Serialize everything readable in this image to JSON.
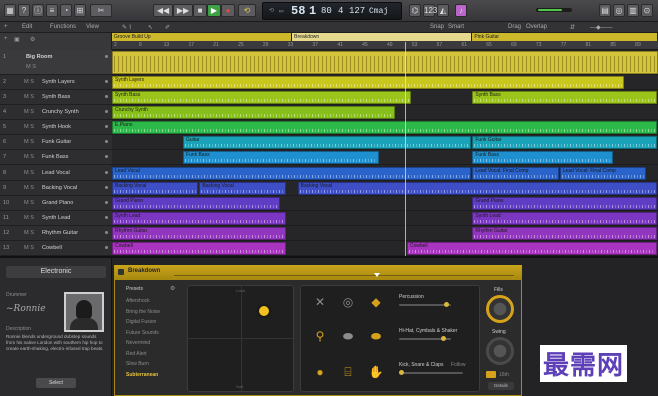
{
  "transport": {
    "rewind_label": "◀◀",
    "forward_label": "▶▶",
    "play_label": "▶",
    "record_label": "●",
    "cycle_label": "⟲"
  },
  "lcd": {
    "bar": "58",
    "beat": "1",
    "bpm": "80",
    "time_sig_top": "4",
    "time_sig": "127",
    "key": "Cmaj"
  },
  "options_bar": {
    "edit": "Edit",
    "functions": "Functions",
    "view": "View",
    "snap_label": "Snap",
    "snap_value": "Smart",
    "drag_label": "Drag",
    "drag_value": "Overlap"
  },
  "ruler_ticks": [
    "2",
    "9",
    "13",
    "17",
    "21",
    "25",
    "29",
    "33",
    "37",
    "41",
    "45",
    "49",
    "53",
    "57",
    "61",
    "65",
    "69",
    "73",
    "77",
    "81",
    "85",
    "89"
  ],
  "arrangement": [
    {
      "label": "Groove Build Up",
      "start": 0,
      "end": 0.33,
      "color": "#cdb72a"
    },
    {
      "label": "Breakdown",
      "start": 0.33,
      "end": 0.66,
      "color": "#e6d98e"
    },
    {
      "label": "Pink Guitar",
      "start": 0.66,
      "end": 1,
      "color": "#cdb72a"
    }
  ],
  "tracks": [
    {
      "num": "1",
      "name": "Big Room",
      "color": "#cdb72a"
    },
    {
      "num": "2",
      "name": "Synth Layers",
      "color": "#c9c61e"
    },
    {
      "num": "3",
      "name": "Synth Bass",
      "color": "#9bc51b"
    },
    {
      "num": "4",
      "name": "Crunchy Synth",
      "color": "#86bf19"
    },
    {
      "num": "5",
      "name": "Synth Hook",
      "color": "#2db84a"
    },
    {
      "num": "6",
      "name": "Funk Guitar",
      "color": "#1aa3b8"
    },
    {
      "num": "7",
      "name": "Funk Bass",
      "color": "#1e8fcf"
    },
    {
      "num": "8",
      "name": "Lead Vocal",
      "color": "#2a63c9"
    },
    {
      "num": "9",
      "name": "Backing Vocal",
      "color": "#3d4ec7"
    },
    {
      "num": "10",
      "name": "Grand Piano",
      "color": "#5f3dc4"
    },
    {
      "num": "11",
      "name": "Synth Lead",
      "color": "#7b37c2"
    },
    {
      "num": "12",
      "name": "Rhythm Guitar",
      "color": "#9336bf"
    },
    {
      "num": "13",
      "name": "Cowbell",
      "color": "#a834c0"
    }
  ],
  "regions": [
    {
      "row": 1,
      "label": "Synth Layers",
      "start": 0,
      "end": 0.94,
      "color": "#c9c61e"
    },
    {
      "row": 2,
      "label": "Synth Bass",
      "start": 0,
      "end": 0.55,
      "color": "#9bc51b"
    },
    {
      "row": 2,
      "label": "Synth Bass",
      "start": 0.66,
      "end": 1,
      "color": "#9bc51b"
    },
    {
      "row": 3,
      "label": "Crunchy Synth",
      "start": 0,
      "end": 0.52,
      "color": "#86bf19"
    },
    {
      "row": 4,
      "label": "E.Piano",
      "start": 0,
      "end": 1,
      "color": "#2db84a"
    },
    {
      "row": 5,
      "label": "Guitar",
      "start": 0.13,
      "end": 0.66,
      "color": "#1aa3b8"
    },
    {
      "row": 5,
      "label": "Funk Guitar",
      "start": 0.66,
      "end": 1,
      "color": "#1aa3b8"
    },
    {
      "row": 6,
      "label": "Funk Bass",
      "start": 0.13,
      "end": 0.49,
      "color": "#1e8fcf"
    },
    {
      "row": 6,
      "label": "Funk Bass",
      "start": 0.66,
      "end": 0.92,
      "color": "#1e8fcf"
    },
    {
      "row": 7,
      "label": "Lead Vocal",
      "start": 0,
      "end": 0.66,
      "color": "#2a63c9"
    },
    {
      "row": 7,
      "label": "Lead Vocal: Final Comp",
      "start": 0.66,
      "end": 0.82,
      "color": "#2a63c9"
    },
    {
      "row": 7,
      "label": "Lead Vocal: Final Comp",
      "start": 0.82,
      "end": 0.98,
      "color": "#2a63c9"
    },
    {
      "row": 8,
      "label": "Backing Vocal",
      "start": 0,
      "end": 0.16,
      "color": "#3d4ec7"
    },
    {
      "row": 8,
      "label": "Backing Vocal",
      "start": 0.16,
      "end": 0.32,
      "color": "#3d4ec7"
    },
    {
      "row": 8,
      "label": "Backing Vocal",
      "start": 0.34,
      "end": 1,
      "color": "#3d4ec7"
    },
    {
      "row": 9,
      "label": "Grand Piano",
      "start": 0,
      "end": 0.31,
      "color": "#5f3dc4"
    },
    {
      "row": 9,
      "label": "Grand Piano",
      "start": 0.66,
      "end": 1,
      "color": "#5f3dc4"
    },
    {
      "row": 10,
      "label": "Synth Lead",
      "start": 0,
      "end": 0.32,
      "color": "#7b37c2"
    },
    {
      "row": 10,
      "label": "Synth Lead",
      "start": 0.66,
      "end": 1,
      "color": "#7b37c2"
    },
    {
      "row": 11,
      "label": "Rhythm Guitar",
      "start": 0,
      "end": 0.32,
      "color": "#9336bf"
    },
    {
      "row": 11,
      "label": "Rhythm Guitar",
      "start": 0.66,
      "end": 1,
      "color": "#9336bf"
    },
    {
      "row": 12,
      "label": "Cowbell",
      "start": 0,
      "end": 0.32,
      "color": "#a834c0"
    },
    {
      "row": 12,
      "label": "Cowbell",
      "start": 0.54,
      "end": 1,
      "color": "#a834c0"
    }
  ],
  "library": {
    "title": "Electronic",
    "drummer_label": "Drummer",
    "description_label": "Description",
    "description": "Ronnie blends underground dubstep sounds from his native London with southern hip hop to create earth-shaking, electro-infused trap beats.",
    "select_button": "Select"
  },
  "smart_panel": {
    "title": "Breakdown",
    "presets_label": "Presets",
    "presets": [
      "Aftershock",
      "Bring the Noise",
      "Digital Fusion",
      "Future Sounds",
      "Nevermind",
      "Red Alert",
      "Slow Burn",
      "Subterranean"
    ],
    "selected_preset": "Subterranean",
    "xy_top": "Loud",
    "xy_bottom": "Soft",
    "xy_left": "Simple",
    "xy_right": "Complex",
    "percussion_label": "Percussion",
    "hihat_label": "Hi-Hat, Cymbals & Shaker",
    "kick_label": "Kick, Snare & Claps",
    "follow_label": "Follow",
    "fills_label": "Fills",
    "swing_label": "Swing",
    "details_label": "Details",
    "swing_value": "16th",
    "puck_x": 0.72,
    "puck_y": 0.24
  },
  "watermark": "最需网",
  "colors": {
    "accent": "#c9a51c",
    "play_green": "#3da146",
    "lcd_bg": "#181b1f"
  }
}
